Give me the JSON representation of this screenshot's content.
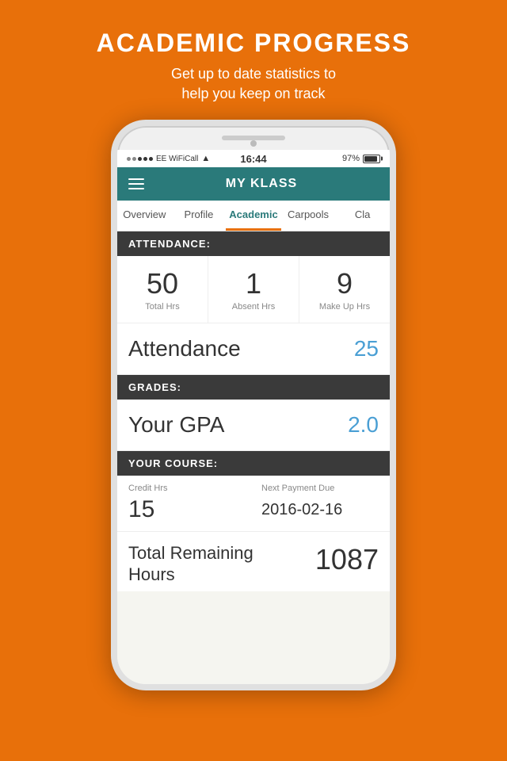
{
  "page": {
    "bg_color": "#E8700A",
    "header": {
      "title": "ACADEMIC PROGRESS",
      "subtitle": "Get up to date statistics to\nhelp you keep on track"
    }
  },
  "status_bar": {
    "carrier": "●●○○○ EE WiFiCall",
    "wifi": "WiFi",
    "time": "16:44",
    "battery_icon": "⊙",
    "battery_pct": "97%"
  },
  "nav": {
    "title": "MY KLASS",
    "hamburger_label": "Menu"
  },
  "tabs": [
    {
      "id": "overview",
      "label": "Overview",
      "active": false
    },
    {
      "id": "profile",
      "label": "Profile",
      "active": false
    },
    {
      "id": "academic",
      "label": "Academic",
      "active": true
    },
    {
      "id": "carpools",
      "label": "Carpools",
      "active": false
    },
    {
      "id": "classes",
      "label": "Cla...",
      "active": false
    }
  ],
  "attendance_section": {
    "header": "ATTENDANCE:",
    "stats": [
      {
        "number": "50",
        "label": "Total Hrs"
      },
      {
        "number": "1",
        "label": "Absent Hrs"
      },
      {
        "number": "9",
        "label": "Make Up Hrs"
      }
    ]
  },
  "attendance_summary": {
    "label": "Attendance",
    "value": "25"
  },
  "grades_section": {
    "header": "GRADES:",
    "gpa_label": "Your GPA",
    "gpa_value": "2.0"
  },
  "course_section": {
    "header": "YOUR COURSE:",
    "credit_hrs_label": "Credit Hrs",
    "credit_hrs_value": "15",
    "next_payment_label": "Next Payment Due",
    "next_payment_value": "2016-02-16"
  },
  "total_remaining": {
    "label": "Total Remaining\nHours",
    "value": "1087"
  }
}
